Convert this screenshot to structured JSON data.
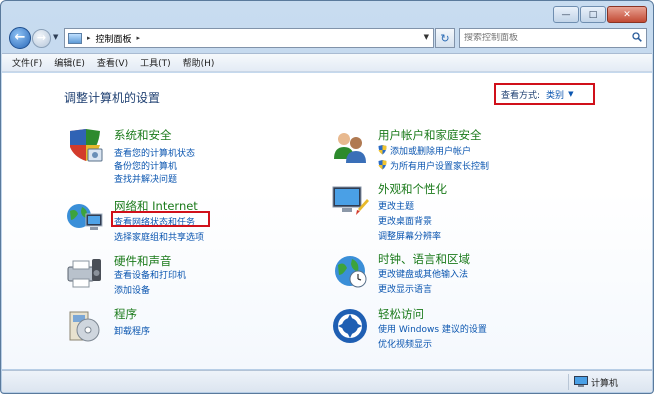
{
  "window": {
    "caption_buttons": [
      "minimize",
      "maximize",
      "close"
    ]
  },
  "address_bar": {
    "path": "控制面板",
    "separator": "▸",
    "back_icon": "back-arrow-icon",
    "forward_icon": "forward-arrow-icon"
  },
  "search": {
    "placeholder": "搜索控制面板"
  },
  "menu": {
    "items": [
      "文件(F)",
      "编辑(E)",
      "查看(V)",
      "工具(T)",
      "帮助(H)"
    ]
  },
  "main": {
    "title": "调整计算机的设置",
    "view_by_label": "查看方式:",
    "view_by_value": "类别"
  },
  "categories": [
    {
      "title": "系统和安全",
      "icon": "shield-security-icon",
      "links": [
        "查看您的计算机状态",
        "备份您的计算机",
        "查找并解决问题"
      ]
    },
    {
      "title": "网络和 Internet",
      "icon": "network-globe-icon",
      "links": [
        "查看网络状态和任务",
        "选择家庭组和共享选项"
      ]
    },
    {
      "title": "硬件和声音",
      "icon": "printer-speaker-icon",
      "links": [
        "查看设备和打印机",
        "添加设备"
      ]
    },
    {
      "title": "程序",
      "icon": "programs-disk-icon",
      "links": [
        "卸载程序"
      ]
    },
    {
      "title": "用户帐户和家庭安全",
      "icon": "users-icon",
      "links": [
        "添加或删除用户帐户",
        "为所有用户设置家长控制"
      ]
    },
    {
      "title": "外观和个性化",
      "icon": "monitor-personalize-icon",
      "links": [
        "更改主题",
        "更改桌面背景",
        "调整屏幕分辨率"
      ]
    },
    {
      "title": "时钟、语言和区域",
      "icon": "clock-globe-icon",
      "links": [
        "更改键盘或其他输入法",
        "更改显示语言"
      ]
    },
    {
      "title": "轻松访问",
      "icon": "ease-of-access-icon",
      "links": [
        "使用 Windows 建议的设置",
        "优化视频显示"
      ]
    }
  ],
  "statusbar": {
    "text": "计算机"
  },
  "colors": {
    "highlight": "#d0101a",
    "link": "#0b56b0",
    "category_title": "#1b7a1b",
    "page_title": "#1e3f71"
  }
}
